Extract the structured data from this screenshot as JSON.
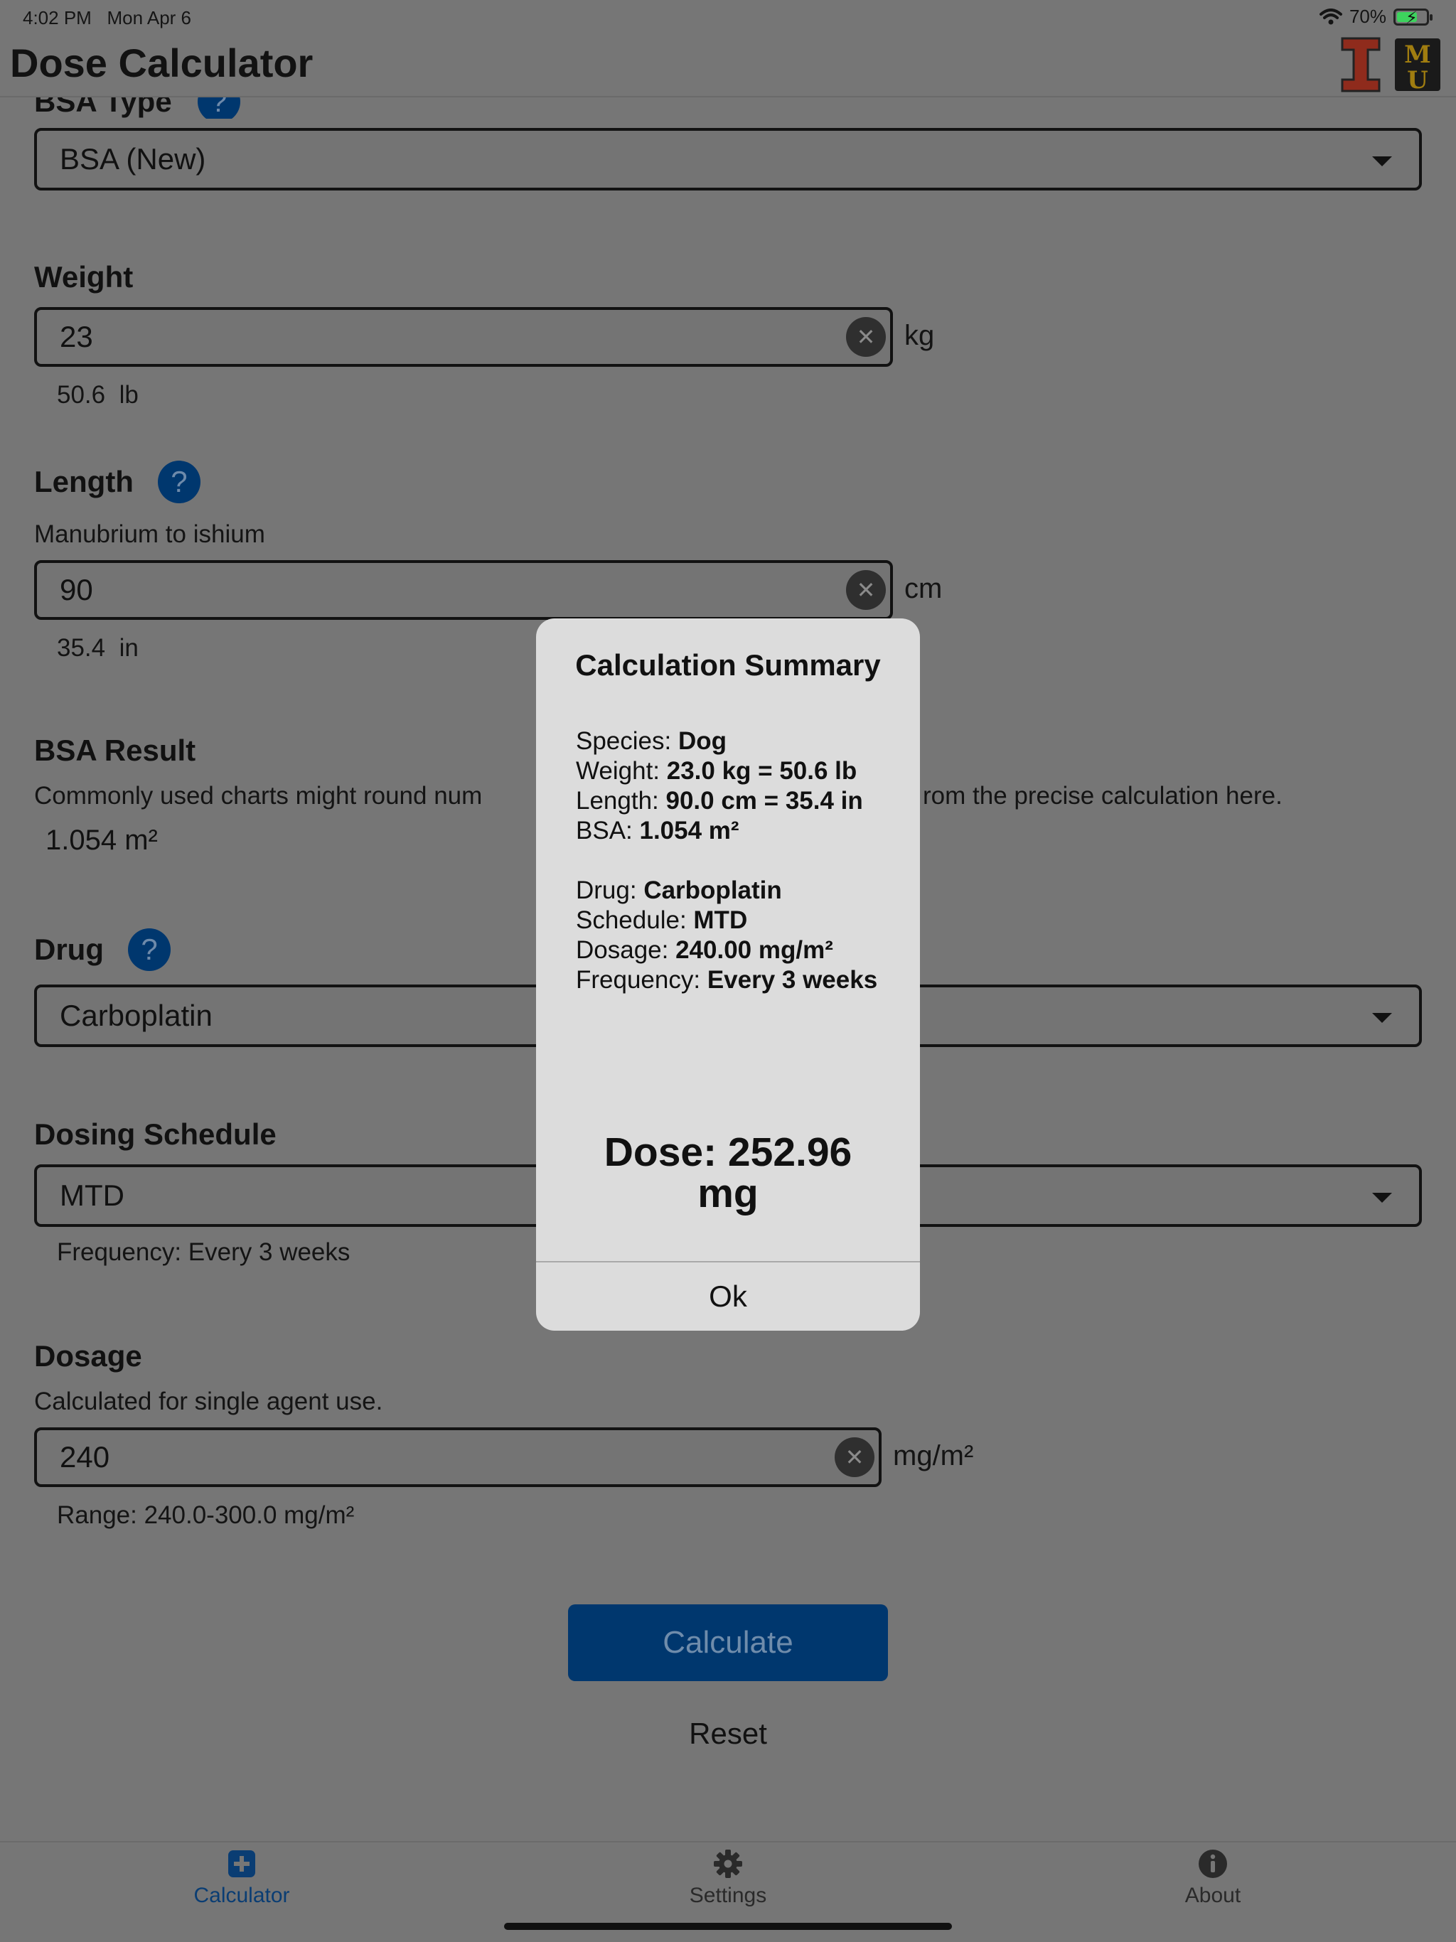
{
  "status_bar": {
    "time": "4:02 PM",
    "date": "Mon Apr 6",
    "battery": "70%",
    "battery_level": 0.7
  },
  "nav": {
    "title": "Dose Calculator"
  },
  "bsa_type": {
    "label": "BSA Type",
    "value": "BSA (New)"
  },
  "weight": {
    "label": "Weight",
    "value": "23",
    "unit": "kg",
    "converted": "50.6  lb"
  },
  "length": {
    "label": "Length",
    "hint": "Manubrium to ishium",
    "value": "90",
    "unit": "cm",
    "converted": "35.4  in"
  },
  "bsa_result": {
    "label": "BSA Result",
    "note_left": "Commonly used charts might round num",
    "note_right": "rom the precise calculation here.",
    "value": "1.054 m²"
  },
  "drug": {
    "label": "Drug",
    "value": "Carboplatin"
  },
  "dosing_schedule": {
    "label": "Dosing Schedule",
    "value": "MTD",
    "frequency": "Frequency: Every 3 weeks"
  },
  "dosage": {
    "label": "Dosage",
    "hint": "Calculated for single agent use.",
    "value": "240",
    "unit": "mg/m²",
    "range": "Range: 240.0-300.0 mg/m²"
  },
  "buttons": {
    "calculate": "Calculate",
    "reset": "Reset"
  },
  "modal": {
    "title": "Calculation Summary",
    "species_label": "Species: ",
    "species_value": "Dog",
    "weight_label": "Weight: ",
    "weight_value": "23.0 kg = 50.6 lb",
    "length_label": "Length: ",
    "length_value": "90.0 cm = 35.4 in",
    "bsa_label": "BSA: ",
    "bsa_value": "1.054 m²",
    "drug_label": "Drug: ",
    "drug_value": "Carboplatin",
    "schedule_label": "Schedule: ",
    "schedule_value": "MTD",
    "dosage_label": "Dosage: ",
    "dosage_value": "240.00 mg/m²",
    "frequency_label": "Frequency: ",
    "frequency_value": "Every 3 weeks",
    "dose": "Dose: 252.96 mg",
    "ok": "Ok"
  },
  "tabbar": {
    "calculator": "Calculator",
    "settings": "Settings",
    "about": "About"
  },
  "colors": {
    "accent": "#00376e",
    "overlay_bg": "#767676",
    "modal_bg": "#dcdcdc"
  },
  "icons": [
    "wifi-icon",
    "battery-icon",
    "help-icon",
    "clear-icon",
    "dropdown-caret-icon",
    "plus-square-icon",
    "gear-icon",
    "info-icon"
  ]
}
